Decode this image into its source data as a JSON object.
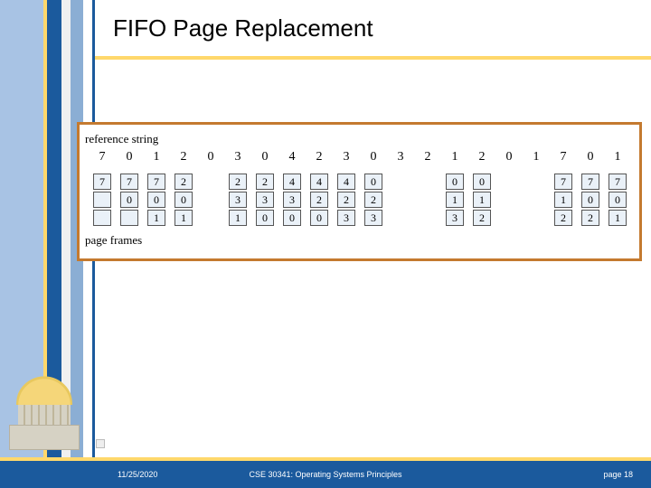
{
  "title": "FIFO Page Replacement",
  "labels": {
    "reference": "reference string",
    "frames": "page frames"
  },
  "reference_string": [
    "7",
    "0",
    "1",
    "2",
    "0",
    "3",
    "0",
    "4",
    "2",
    "3",
    "0",
    "3",
    "2",
    "1",
    "2",
    "0",
    "1",
    "7",
    "0",
    "1"
  ],
  "columns": [
    {
      "show": true,
      "cells": [
        "7",
        "",
        ""
      ]
    },
    {
      "show": true,
      "cells": [
        "7",
        "0",
        ""
      ]
    },
    {
      "show": true,
      "cells": [
        "7",
        "0",
        "1"
      ]
    },
    {
      "show": true,
      "cells": [
        "2",
        "0",
        "1"
      ]
    },
    {
      "show": false,
      "cells": [
        "",
        "",
        ""
      ]
    },
    {
      "show": true,
      "cells": [
        "2",
        "3",
        "1"
      ]
    },
    {
      "show": true,
      "cells": [
        "2",
        "3",
        "0"
      ]
    },
    {
      "show": true,
      "cells": [
        "4",
        "3",
        "0"
      ]
    },
    {
      "show": true,
      "cells": [
        "4",
        "2",
        "0"
      ]
    },
    {
      "show": true,
      "cells": [
        "4",
        "2",
        "3"
      ]
    },
    {
      "show": true,
      "cells": [
        "0",
        "2",
        "3"
      ]
    },
    {
      "show": false,
      "cells": [
        "",
        "",
        ""
      ]
    },
    {
      "show": false,
      "cells": [
        "",
        "",
        ""
      ]
    },
    {
      "show": true,
      "cells": [
        "0",
        "1",
        "3"
      ]
    },
    {
      "show": true,
      "cells": [
        "0",
        "1",
        "2"
      ]
    },
    {
      "show": false,
      "cells": [
        "",
        "",
        ""
      ]
    },
    {
      "show": false,
      "cells": [
        "",
        "",
        ""
      ]
    },
    {
      "show": true,
      "cells": [
        "7",
        "1",
        "2"
      ]
    },
    {
      "show": true,
      "cells": [
        "7",
        "0",
        "2"
      ]
    },
    {
      "show": true,
      "cells": [
        "7",
        "0",
        "1"
      ]
    }
  ],
  "footer": {
    "date": "11/25/2020",
    "course": "CSE 30341: Operating Systems Principles",
    "page": "page 18"
  }
}
